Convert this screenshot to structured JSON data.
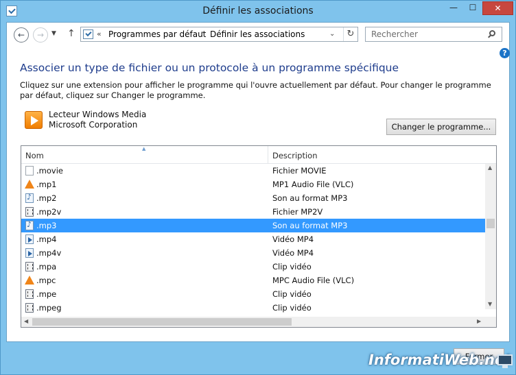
{
  "window": {
    "title": "Définir les associations",
    "minimize_glyph": "—",
    "maximize_glyph": "☐",
    "close_glyph": "✕"
  },
  "nav": {
    "back_glyph": "←",
    "forward_glyph": "→",
    "history_glyph": "▼",
    "up_glyph": "↑",
    "breadcrumb_prefix": "«",
    "breadcrumb_separator": "›",
    "breadcrumbs": [
      "Programmes par défaut",
      "Définir les associations"
    ],
    "dropdown_glyph": "⌄",
    "refresh_glyph": "↻",
    "search_placeholder": "Rechercher"
  },
  "help_glyph": "?",
  "page": {
    "heading": "Associer un type de fichier ou un protocole à un programme spécifique",
    "description": "Cliquez sur une extension pour afficher le programme qui l'ouvre actuellement par défaut. Pour changer le programme par défaut, cliquez sur Changer le programme."
  },
  "program": {
    "name": "Lecteur Windows Media",
    "company": "Microsoft Corporation",
    "change_button": "Changer le programme..."
  },
  "list": {
    "columns": [
      "Nom",
      "Description"
    ],
    "sort_glyph": "▲",
    "rows": [
      {
        "ext": ".movie",
        "desc": "Fichier MOVIE",
        "icon": "blank-file-icon"
      },
      {
        "ext": ".mp1",
        "desc": "MP1 Audio File (VLC)",
        "icon": "vlc-cone-icon"
      },
      {
        "ext": ".mp2",
        "desc": "Son au format MP3",
        "icon": "audio-file-icon"
      },
      {
        "ext": ".mp2v",
        "desc": "Fichier MP2V",
        "icon": "video-file-icon"
      },
      {
        "ext": ".mp3",
        "desc": "Son au format MP3",
        "icon": "audio-file-icon",
        "selected": true
      },
      {
        "ext": ".mp4",
        "desc": "Vidéo MP4",
        "icon": "mp4-file-icon"
      },
      {
        "ext": ".mp4v",
        "desc": "Vidéo MP4",
        "icon": "mp4-file-icon"
      },
      {
        "ext": ".mpa",
        "desc": "Clip vidéo",
        "icon": "video-file-icon"
      },
      {
        "ext": ".mpc",
        "desc": "MPC Audio File (VLC)",
        "icon": "vlc-cone-icon"
      },
      {
        "ext": ".mpe",
        "desc": "Clip vidéo",
        "icon": "video-file-icon"
      },
      {
        "ext": ".mpeg",
        "desc": "Clip vidéo",
        "icon": "video-file-icon"
      }
    ],
    "scroll_up_glyph": "▲",
    "scroll_down_glyph": "▼",
    "scroll_left_glyph": "◀",
    "scroll_right_glyph": "▶"
  },
  "footer": {
    "close_button": "Fermer"
  },
  "watermark": "InformatiWeb.net",
  "colors": {
    "selection": "#3399ff",
    "heading": "#1e3c8c",
    "frame": "#7fc3ec"
  }
}
